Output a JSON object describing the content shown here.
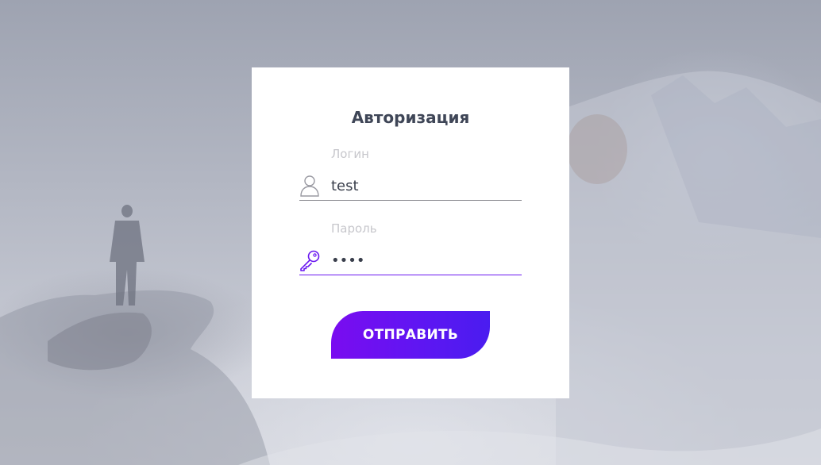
{
  "form": {
    "title": "Авторизация",
    "login": {
      "label": "Логин",
      "value": "test",
      "icon": "user-icon"
    },
    "password": {
      "label": "Пароль",
      "value": "••••",
      "icon": "key-icon"
    },
    "submit_label": "ОТПРАВИТЬ"
  },
  "colors": {
    "accent_start": "#7a0cf0",
    "accent_end": "#4a1cf0",
    "title": "#3f4657",
    "label": "#c7c7cc"
  }
}
